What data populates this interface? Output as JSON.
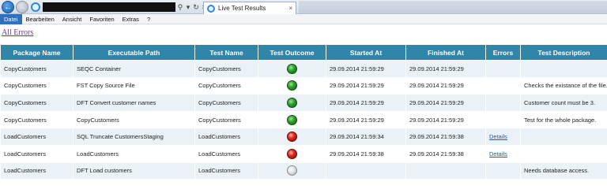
{
  "browser": {
    "tab_title": "Live Test Results",
    "tab_close": "×",
    "menu": [
      "Datei",
      "Bearbeiten",
      "Ansicht",
      "Favoriten",
      "Extras",
      "?"
    ],
    "active_menu_index": 0
  },
  "page": {
    "all_errors_link": "All Errors",
    "columns": [
      "Package Name",
      "Executable Path",
      "Test Name",
      "Test Outcome",
      "Started At",
      "Finished At",
      "Errors",
      "Test Description"
    ],
    "rows": [
      {
        "package": "CopyCustomers",
        "path": "SEQC Container",
        "test": "CopyCustomers",
        "outcome": "green",
        "started": "29.09.2014 21:59:29",
        "finished": "29.09.2014 21:59:29",
        "errors": "",
        "description": ""
      },
      {
        "package": "CopyCustomers",
        "path": "FST Copy Source File",
        "test": "CopyCustomers",
        "outcome": "green",
        "started": "29.09.2014 21:59:29",
        "finished": "29.09.2014 21:59:29",
        "errors": "",
        "description": "Checks the existance of the file."
      },
      {
        "package": "CopyCustomers",
        "path": "DFT Convert customer names",
        "test": "CopyCustomers",
        "outcome": "green",
        "started": "29.09.2014 21:59:29",
        "finished": "29.09.2014 21:59:29",
        "errors": "",
        "description": "Customer count must be 3."
      },
      {
        "package": "CopyCustomers",
        "path": "CopyCustomers",
        "test": "CopyCustomers",
        "outcome": "green",
        "started": "29.09.2014 21:59:29",
        "finished": "29.09.2014 21:59:29",
        "errors": "",
        "description": "Test for the whole package."
      },
      {
        "package": "LoadCustomers",
        "path": "SQL Truncate CustomersStaging",
        "test": "LoadCustomers",
        "outcome": "red",
        "started": "29.09.2014 21:59:34",
        "finished": "29.09.2014 21:59:38",
        "errors": "Details",
        "description": ""
      },
      {
        "package": "LoadCustomers",
        "path": "LoadCustomers",
        "test": "LoadCustomers",
        "outcome": "red",
        "started": "29.09.2014 21:59:38",
        "finished": "29.09.2014 21:59:38",
        "errors": "Details",
        "description": ""
      },
      {
        "package": "LoadCustomers",
        "path": "DFT Load customers",
        "test": "LoadCustomers",
        "outcome": "gray",
        "started": "",
        "finished": "",
        "errors": "",
        "description": "Needs database access."
      }
    ]
  }
}
